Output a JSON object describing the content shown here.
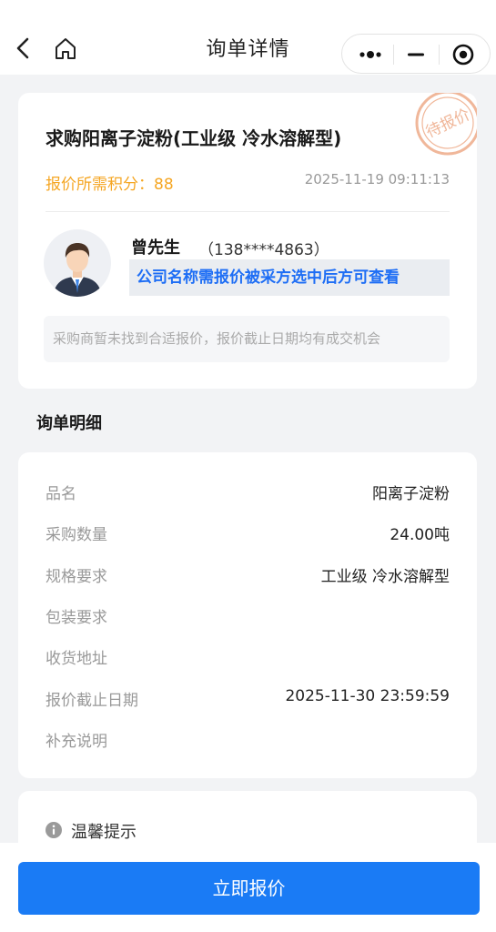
{
  "nav": {
    "title": "询单详情"
  },
  "inquiry": {
    "title": "求购阳离子淀粉(工业级 冷水溶解型)",
    "points_label": "报价所需积分：",
    "points_value": "88",
    "publish_time": "2025-11-19 09:11:13",
    "status_stamp": "待报价"
  },
  "contact": {
    "name": "曾先生",
    "phone": "（138****4863）",
    "company_hidden_text": "公司名称需报价被采方选中后方可查看"
  },
  "notice": "采购商暂未找到合适报价，报价截止日期均有成交机会",
  "details": {
    "section_title": "询单明细",
    "rows": [
      {
        "label": "品名",
        "value": "阳离子淀粉"
      },
      {
        "label": "采购数量",
        "value": "24.00吨"
      },
      {
        "label": "规格要求",
        "value": "工业级 冷水溶解型"
      },
      {
        "label": "包装要求",
        "value": ""
      },
      {
        "label": "收货地址",
        "value": ""
      },
      {
        "label": "报价截止日期",
        "value": "2025-11-30 23:59:59"
      },
      {
        "label": "补充说明",
        "value": ""
      }
    ]
  },
  "tips": {
    "title": "温馨提示"
  },
  "actions": {
    "quote_label": "立即报价"
  },
  "colors": {
    "accent": "#1a7bf5",
    "points": "#f5a623",
    "company_text": "#1e6ef5",
    "stamp": "#f0b79a"
  },
  "icons": [
    "back-icon",
    "home-icon",
    "more-dots-icon",
    "minimize-icon",
    "close-target-icon",
    "avatar",
    "info-icon"
  ]
}
